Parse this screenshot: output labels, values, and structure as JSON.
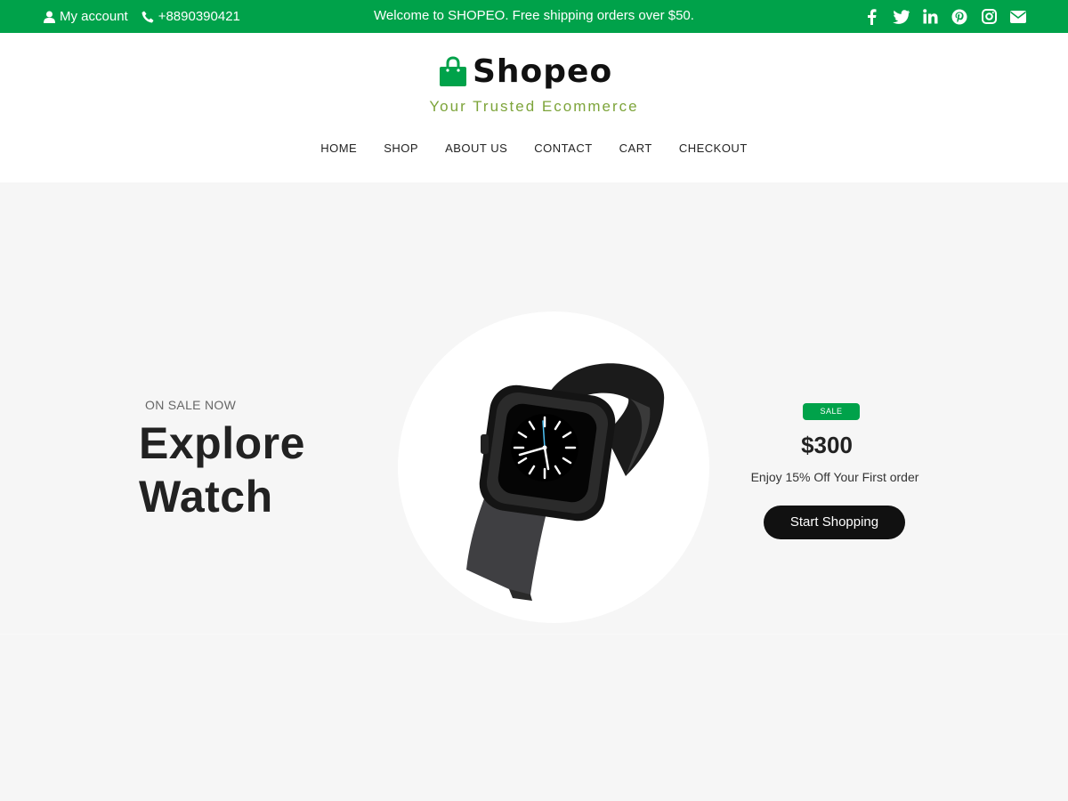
{
  "topbar": {
    "account_label": "My account",
    "phone": "+8890390421",
    "welcome": "Welcome to SHOPEO. Free shipping orders over $50.",
    "social_icons": [
      "facebook-icon",
      "twitter-icon",
      "linkedin-icon",
      "pinterest-icon",
      "instagram-icon",
      "envelope-icon"
    ],
    "bg_color": "#00a24a"
  },
  "header": {
    "logo_text": "Shopeo",
    "tagline": "Your Trusted Ecommerce",
    "nav": [
      "HOME",
      "SHOP",
      "ABOUT US",
      "CONTACT",
      "CART",
      "CHECKOUT"
    ]
  },
  "hero": {
    "kicker": "ON SALE NOW",
    "headline_line1": "Explore",
    "headline_line2": "Watch",
    "badge": "SALE",
    "price": "$300",
    "offer": "Enjoy 15% Off Your First order",
    "cta": "Start Shopping"
  },
  "colors": {
    "accent": "#00a24a",
    "tagline": "#7da43a",
    "dark": "#111111",
    "background": "#f6f6f6"
  }
}
